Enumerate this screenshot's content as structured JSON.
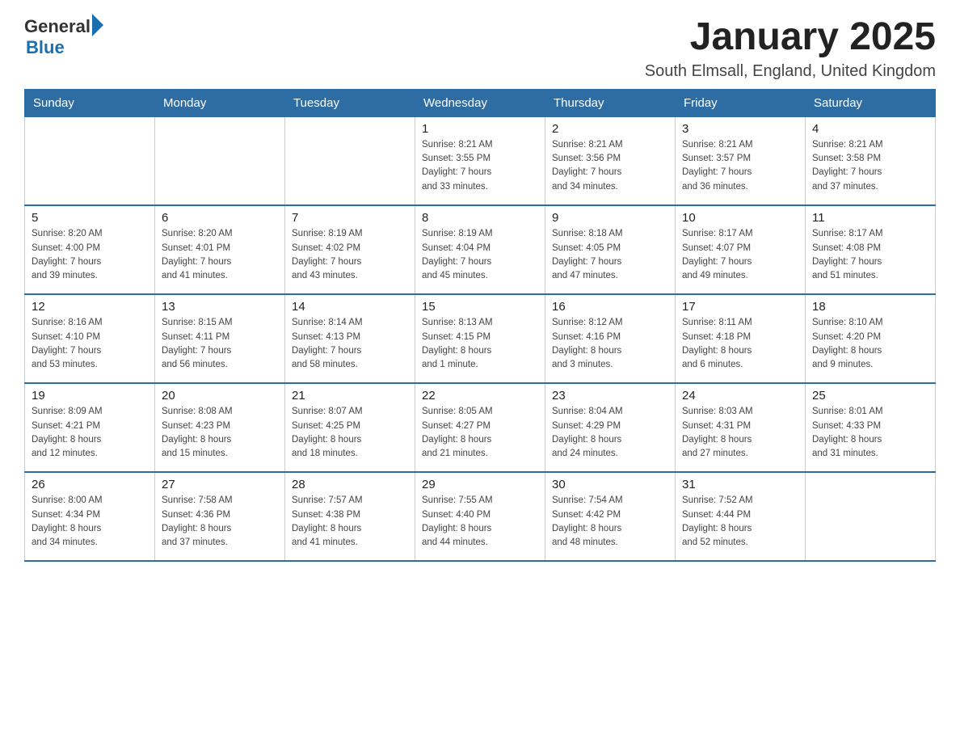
{
  "logo": {
    "general": "General",
    "triangle": "",
    "blue": "Blue"
  },
  "header": {
    "title": "January 2025",
    "subtitle": "South Elmsall, England, United Kingdom"
  },
  "weekdays": [
    "Sunday",
    "Monday",
    "Tuesday",
    "Wednesday",
    "Thursday",
    "Friday",
    "Saturday"
  ],
  "weeks": [
    [
      {
        "day": "",
        "info": ""
      },
      {
        "day": "",
        "info": ""
      },
      {
        "day": "",
        "info": ""
      },
      {
        "day": "1",
        "info": "Sunrise: 8:21 AM\nSunset: 3:55 PM\nDaylight: 7 hours\nand 33 minutes."
      },
      {
        "day": "2",
        "info": "Sunrise: 8:21 AM\nSunset: 3:56 PM\nDaylight: 7 hours\nand 34 minutes."
      },
      {
        "day": "3",
        "info": "Sunrise: 8:21 AM\nSunset: 3:57 PM\nDaylight: 7 hours\nand 36 minutes."
      },
      {
        "day": "4",
        "info": "Sunrise: 8:21 AM\nSunset: 3:58 PM\nDaylight: 7 hours\nand 37 minutes."
      }
    ],
    [
      {
        "day": "5",
        "info": "Sunrise: 8:20 AM\nSunset: 4:00 PM\nDaylight: 7 hours\nand 39 minutes."
      },
      {
        "day": "6",
        "info": "Sunrise: 8:20 AM\nSunset: 4:01 PM\nDaylight: 7 hours\nand 41 minutes."
      },
      {
        "day": "7",
        "info": "Sunrise: 8:19 AM\nSunset: 4:02 PM\nDaylight: 7 hours\nand 43 minutes."
      },
      {
        "day": "8",
        "info": "Sunrise: 8:19 AM\nSunset: 4:04 PM\nDaylight: 7 hours\nand 45 minutes."
      },
      {
        "day": "9",
        "info": "Sunrise: 8:18 AM\nSunset: 4:05 PM\nDaylight: 7 hours\nand 47 minutes."
      },
      {
        "day": "10",
        "info": "Sunrise: 8:17 AM\nSunset: 4:07 PM\nDaylight: 7 hours\nand 49 minutes."
      },
      {
        "day": "11",
        "info": "Sunrise: 8:17 AM\nSunset: 4:08 PM\nDaylight: 7 hours\nand 51 minutes."
      }
    ],
    [
      {
        "day": "12",
        "info": "Sunrise: 8:16 AM\nSunset: 4:10 PM\nDaylight: 7 hours\nand 53 minutes."
      },
      {
        "day": "13",
        "info": "Sunrise: 8:15 AM\nSunset: 4:11 PM\nDaylight: 7 hours\nand 56 minutes."
      },
      {
        "day": "14",
        "info": "Sunrise: 8:14 AM\nSunset: 4:13 PM\nDaylight: 7 hours\nand 58 minutes."
      },
      {
        "day": "15",
        "info": "Sunrise: 8:13 AM\nSunset: 4:15 PM\nDaylight: 8 hours\nand 1 minute."
      },
      {
        "day": "16",
        "info": "Sunrise: 8:12 AM\nSunset: 4:16 PM\nDaylight: 8 hours\nand 3 minutes."
      },
      {
        "day": "17",
        "info": "Sunrise: 8:11 AM\nSunset: 4:18 PM\nDaylight: 8 hours\nand 6 minutes."
      },
      {
        "day": "18",
        "info": "Sunrise: 8:10 AM\nSunset: 4:20 PM\nDaylight: 8 hours\nand 9 minutes."
      }
    ],
    [
      {
        "day": "19",
        "info": "Sunrise: 8:09 AM\nSunset: 4:21 PM\nDaylight: 8 hours\nand 12 minutes."
      },
      {
        "day": "20",
        "info": "Sunrise: 8:08 AM\nSunset: 4:23 PM\nDaylight: 8 hours\nand 15 minutes."
      },
      {
        "day": "21",
        "info": "Sunrise: 8:07 AM\nSunset: 4:25 PM\nDaylight: 8 hours\nand 18 minutes."
      },
      {
        "day": "22",
        "info": "Sunrise: 8:05 AM\nSunset: 4:27 PM\nDaylight: 8 hours\nand 21 minutes."
      },
      {
        "day": "23",
        "info": "Sunrise: 8:04 AM\nSunset: 4:29 PM\nDaylight: 8 hours\nand 24 minutes."
      },
      {
        "day": "24",
        "info": "Sunrise: 8:03 AM\nSunset: 4:31 PM\nDaylight: 8 hours\nand 27 minutes."
      },
      {
        "day": "25",
        "info": "Sunrise: 8:01 AM\nSunset: 4:33 PM\nDaylight: 8 hours\nand 31 minutes."
      }
    ],
    [
      {
        "day": "26",
        "info": "Sunrise: 8:00 AM\nSunset: 4:34 PM\nDaylight: 8 hours\nand 34 minutes."
      },
      {
        "day": "27",
        "info": "Sunrise: 7:58 AM\nSunset: 4:36 PM\nDaylight: 8 hours\nand 37 minutes."
      },
      {
        "day": "28",
        "info": "Sunrise: 7:57 AM\nSunset: 4:38 PM\nDaylight: 8 hours\nand 41 minutes."
      },
      {
        "day": "29",
        "info": "Sunrise: 7:55 AM\nSunset: 4:40 PM\nDaylight: 8 hours\nand 44 minutes."
      },
      {
        "day": "30",
        "info": "Sunrise: 7:54 AM\nSunset: 4:42 PM\nDaylight: 8 hours\nand 48 minutes."
      },
      {
        "day": "31",
        "info": "Sunrise: 7:52 AM\nSunset: 4:44 PM\nDaylight: 8 hours\nand 52 minutes."
      },
      {
        "day": "",
        "info": ""
      }
    ]
  ]
}
